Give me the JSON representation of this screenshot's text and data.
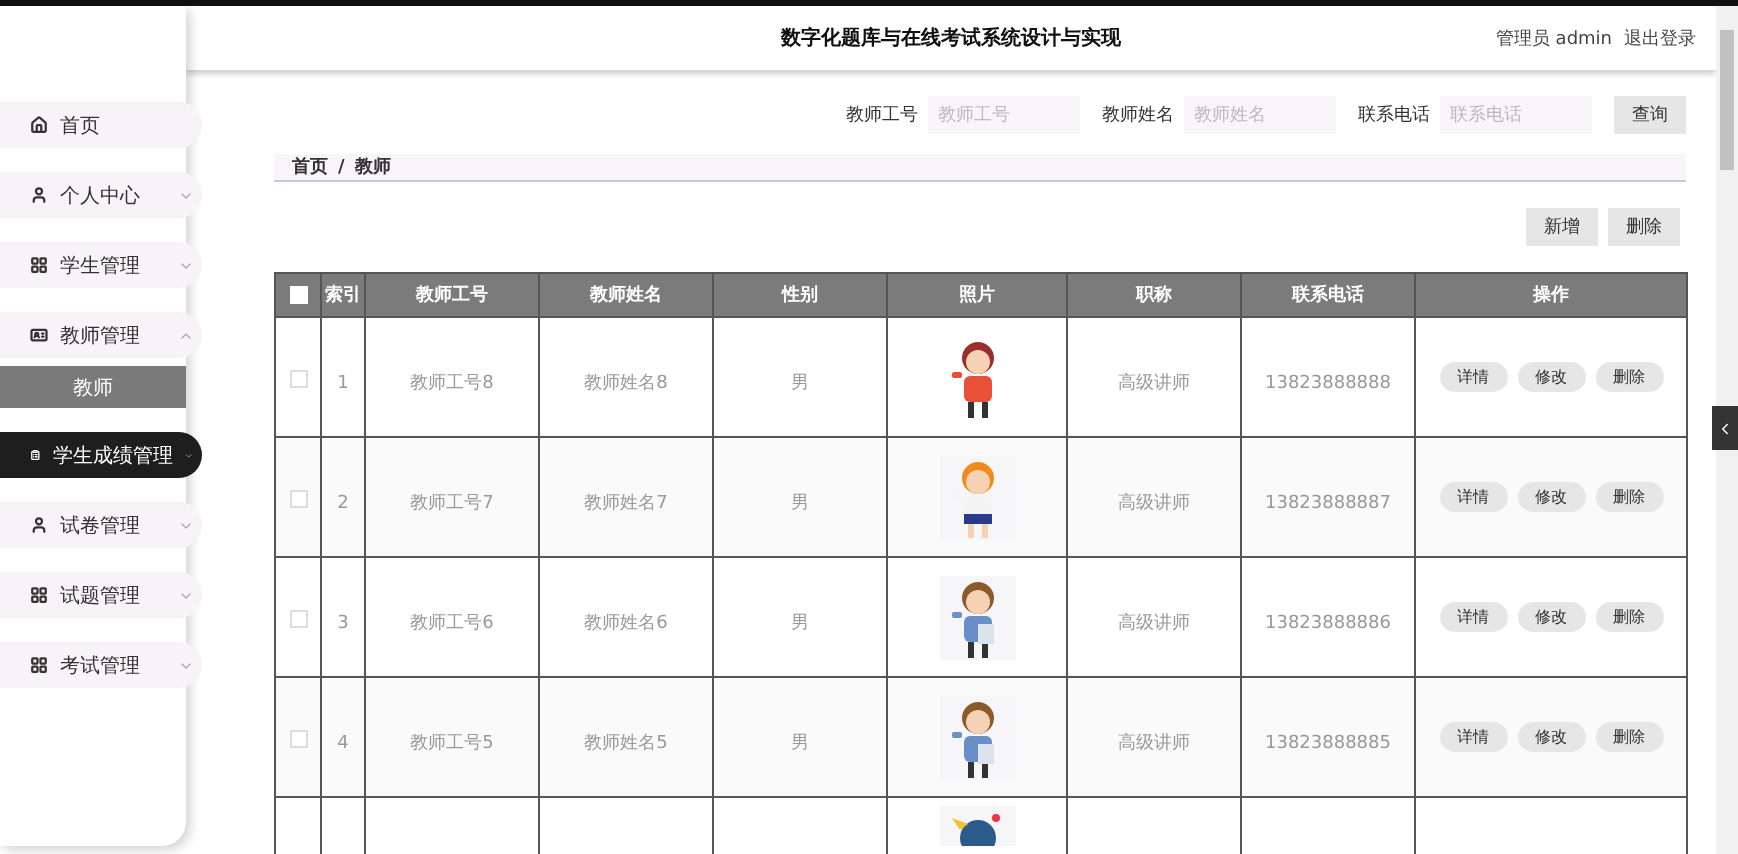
{
  "header": {
    "title": "数字化题库与在线考试系统设计与实现",
    "user": "管理员 admin",
    "logout": "退出登录"
  },
  "sidebar": {
    "items": [
      {
        "label": "首页",
        "kind": "link",
        "selected": false
      },
      {
        "label": "个人中心",
        "kind": "menu",
        "expanded": false,
        "selected": false
      },
      {
        "label": "学生管理",
        "kind": "menu",
        "expanded": false,
        "selected": false
      },
      {
        "label": "教师管理",
        "kind": "menu",
        "expanded": true,
        "selected": false,
        "children": [
          {
            "label": "教师",
            "selected": true
          }
        ]
      },
      {
        "label": "学生成绩管理",
        "kind": "menu",
        "expanded": false,
        "selected": true
      },
      {
        "label": "试卷管理",
        "kind": "menu",
        "expanded": false,
        "selected": false
      },
      {
        "label": "试题管理",
        "kind": "menu",
        "expanded": false,
        "selected": false
      },
      {
        "label": "考试管理",
        "kind": "menu",
        "expanded": false,
        "selected": false
      }
    ]
  },
  "search": {
    "fields": [
      {
        "label": "教师工号",
        "placeholder": "教师工号"
      },
      {
        "label": "教师姓名",
        "placeholder": "教师姓名"
      },
      {
        "label": "联系电话",
        "placeholder": "联系电话"
      }
    ],
    "button": "查询"
  },
  "breadcrumb": {
    "items": [
      "首页",
      "教师"
    ],
    "separator": "/"
  },
  "actions": [
    "新增",
    "删除"
  ],
  "table": {
    "select_all": {
      "checked": false
    },
    "columns": [
      "索引",
      "教师工号",
      "教师姓名",
      "性别",
      "照片",
      "职称",
      "联系电话",
      "操作"
    ],
    "rows": [
      {
        "kind": "full",
        "checked": false,
        "index": "1",
        "id": "教师工号8",
        "name": "教师姓名8",
        "gender": "男",
        "title": "高级讲师",
        "phone": "13823888888",
        "buttons": [
          "详情",
          "修改",
          "删除"
        ]
      },
      {
        "kind": "full",
        "checked": false,
        "index": "2",
        "id": "教师工号7",
        "name": "教师姓名7",
        "gender": "男",
        "title": "高级讲师",
        "phone": "13823888887",
        "buttons": [
          "详情",
          "修改",
          "删除"
        ]
      },
      {
        "kind": "full",
        "checked": false,
        "index": "3",
        "id": "教师工号6",
        "name": "教师姓名6",
        "gender": "男",
        "title": "高级讲师",
        "phone": "13823888886",
        "buttons": [
          "详情",
          "修改",
          "删除"
        ]
      },
      {
        "kind": "full",
        "checked": false,
        "index": "4",
        "id": "教师工号5",
        "name": "教师姓名5",
        "gender": "男",
        "title": "高级讲师",
        "phone": "13823888885",
        "buttons": [
          "详情",
          "修改",
          "删除"
        ]
      },
      {
        "kind": "cut"
      }
    ]
  }
}
